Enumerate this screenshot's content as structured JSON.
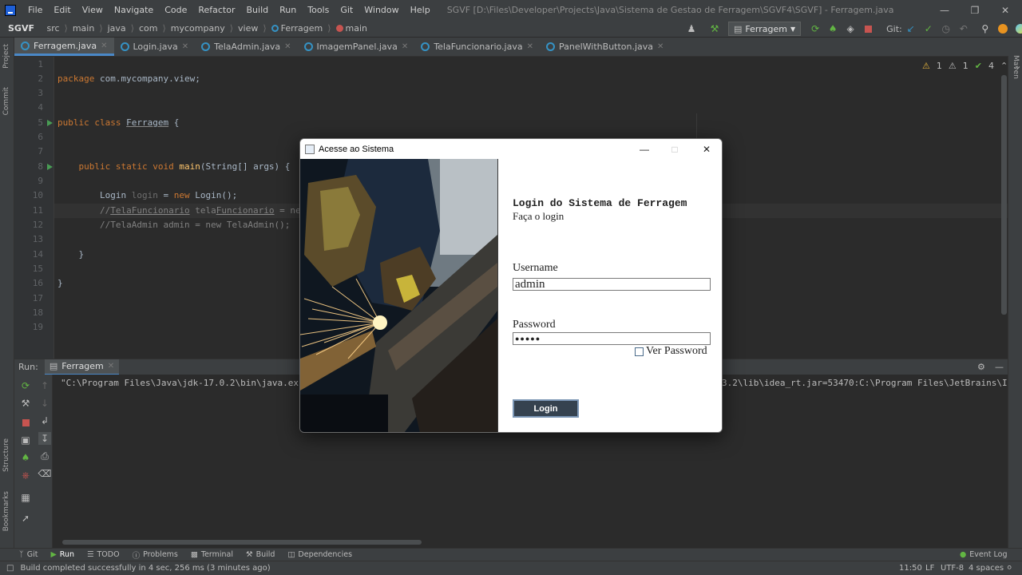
{
  "titlebar": {
    "menus": [
      "File",
      "Edit",
      "View",
      "Navigate",
      "Code",
      "Refactor",
      "Build",
      "Run",
      "Tools",
      "Git",
      "Window",
      "Help"
    ],
    "title": "SGVF [D:\\Files\\Developer\\Projects\\Java\\Sistema de Gestao de Ferragem\\SGVF4\\SGVF] - Ferragem.java"
  },
  "navbar": {
    "crumbs": [
      "SGVF",
      "src",
      "main",
      "java",
      "com",
      "mycompany",
      "view",
      "Ferragem",
      "main"
    ],
    "run_config": "Ferragem",
    "git_label": "Git:"
  },
  "tabs": [
    "Ferragem.java",
    "Login.java",
    "TelaAdmin.java",
    "ImagemPanel.java",
    "TelaFuncionario.java",
    "PanelWithButton.java"
  ],
  "left_stripe": [
    "Project",
    "Commit",
    "Structure",
    "Bookmarks"
  ],
  "right_stripe": [
    "Maven"
  ],
  "editor": {
    "line_numbers": [
      "1",
      "2",
      "3",
      "4",
      "5",
      "6",
      "7",
      "8",
      "9",
      "10",
      "11",
      "12",
      "13",
      "14",
      "15",
      "16",
      "17",
      "18",
      "19"
    ],
    "inspections": {
      "warn1": "1",
      "warn2": "1",
      "ok": "4"
    }
  },
  "run_panel": {
    "label": "Run:",
    "tab": "Ferragem",
    "console_left": "\"C:\\Program Files\\Java\\jdk-17.0.2\\bin\\java.ex",
    "console_right": "3.2\\lib\\idea_rt.jar=53470:C:\\Program Files\\JetBrains\\I"
  },
  "bottom_tabs": [
    "Git",
    "Run",
    "TODO",
    "Problems",
    "Terminal",
    "Build",
    "Dependencies"
  ],
  "event_log": "Event Log",
  "status": {
    "message": "Build completed successfully in 4 sec, 256 ms (3 minutes ago)",
    "position": "11:50",
    "line_sep": "LF",
    "encoding": "UTF-8",
    "indent": "4 spaces"
  },
  "dialog": {
    "title": "Acesse ao Sistema",
    "heading": "Login do Sistema de Ferragem",
    "subheading": "Faça o login",
    "username_label": "Username",
    "username_value": "admin",
    "password_label": "Password",
    "password_value": "●●●●●",
    "show_password_label": "Ver Password",
    "login_button": "Login"
  },
  "colors": {
    "accent": "#4a88c7",
    "login_button": "#35424f",
    "editor_bg": "#2b2b2b"
  }
}
